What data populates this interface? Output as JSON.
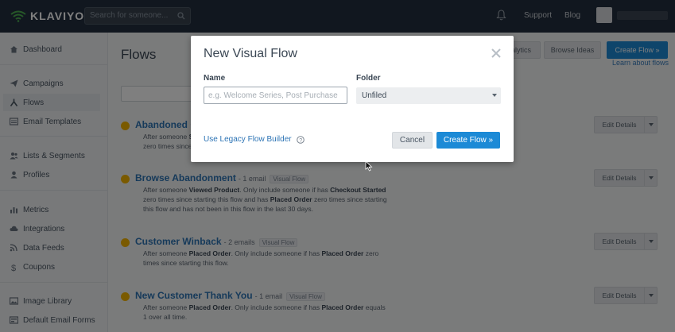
{
  "brand": {
    "name": "KLAVIYO"
  },
  "topbar": {
    "search_placeholder": "Search for someone...",
    "links": [
      "Support",
      "Blog"
    ]
  },
  "sidebar": {
    "items": [
      {
        "label": "Dashboard",
        "icon": "home-icon"
      },
      {
        "label": "Campaigns",
        "icon": "paper-plane-icon"
      },
      {
        "label": "Flows",
        "icon": "flows-icon",
        "active": true
      },
      {
        "label": "Email Templates",
        "icon": "email-template-icon"
      },
      {
        "label": "Lists & Segments",
        "icon": "users-icon"
      },
      {
        "label": "Profiles",
        "icon": "person-icon"
      },
      {
        "label": "Metrics",
        "icon": "bar-chart-icon"
      },
      {
        "label": "Integrations",
        "icon": "cloud-icon"
      },
      {
        "label": "Data Feeds",
        "icon": "rss-icon"
      },
      {
        "label": "Coupons",
        "icon": "dollar-icon"
      },
      {
        "label": "Image Library",
        "icon": "image-icon"
      },
      {
        "label": "Default Email Forms",
        "icon": "form-icon"
      }
    ]
  },
  "main": {
    "title": "Flows",
    "header_buttons": [
      "Analytics",
      "Browse Ideas",
      "Create Flow »"
    ],
    "learn_link": "Learn about flows",
    "flows": [
      {
        "name": "Abandoned Cart",
        "count": "",
        "tag": "",
        "desc_html": "After someone <b>Started Checkout</b>. Only include someone if has <b>Placed Order</b> zero times since starting this flow.",
        "edit_label": "Edit Details"
      },
      {
        "name": "Browse Abandonment",
        "count": "- 1 email",
        "tag": "Visual Flow",
        "desc_html": "After someone <b>Viewed Product</b>. Only include someone if has <b>Checkout Started</b> zero times since starting this flow and has <b>Placed Order</b> zero times since starting this flow and has not been in this flow in the last 30 days.",
        "edit_label": "Edit Details"
      },
      {
        "name": "Customer Winback",
        "count": "- 2 emails",
        "tag": "Visual Flow",
        "desc_html": "After someone <b>Placed Order</b>. Only include someone if has <b>Placed Order</b> zero times since starting this flow.",
        "edit_label": "Edit Details"
      },
      {
        "name": "New Customer Thank You",
        "count": "- 1 email",
        "tag": "Visual Flow",
        "desc_html": "After someone <b>Placed Order</b>. Only include someone if has <b>Placed Order</b> equals 1 over all time.",
        "edit_label": "Edit Details"
      }
    ]
  },
  "modal": {
    "title": "New Visual Flow",
    "name_label": "Name",
    "name_placeholder": "e.g. Welcome Series, Post Purchase",
    "folder_label": "Folder",
    "folder_value": "Unfiled",
    "legacy_link": "Use Legacy Flow Builder",
    "cancel_label": "Cancel",
    "create_label": "Create Flow »"
  },
  "colors": {
    "topbar": "#232f3e",
    "primary": "#1c8ad6",
    "link": "#2d74b5",
    "status_dot": "#f4b400"
  }
}
